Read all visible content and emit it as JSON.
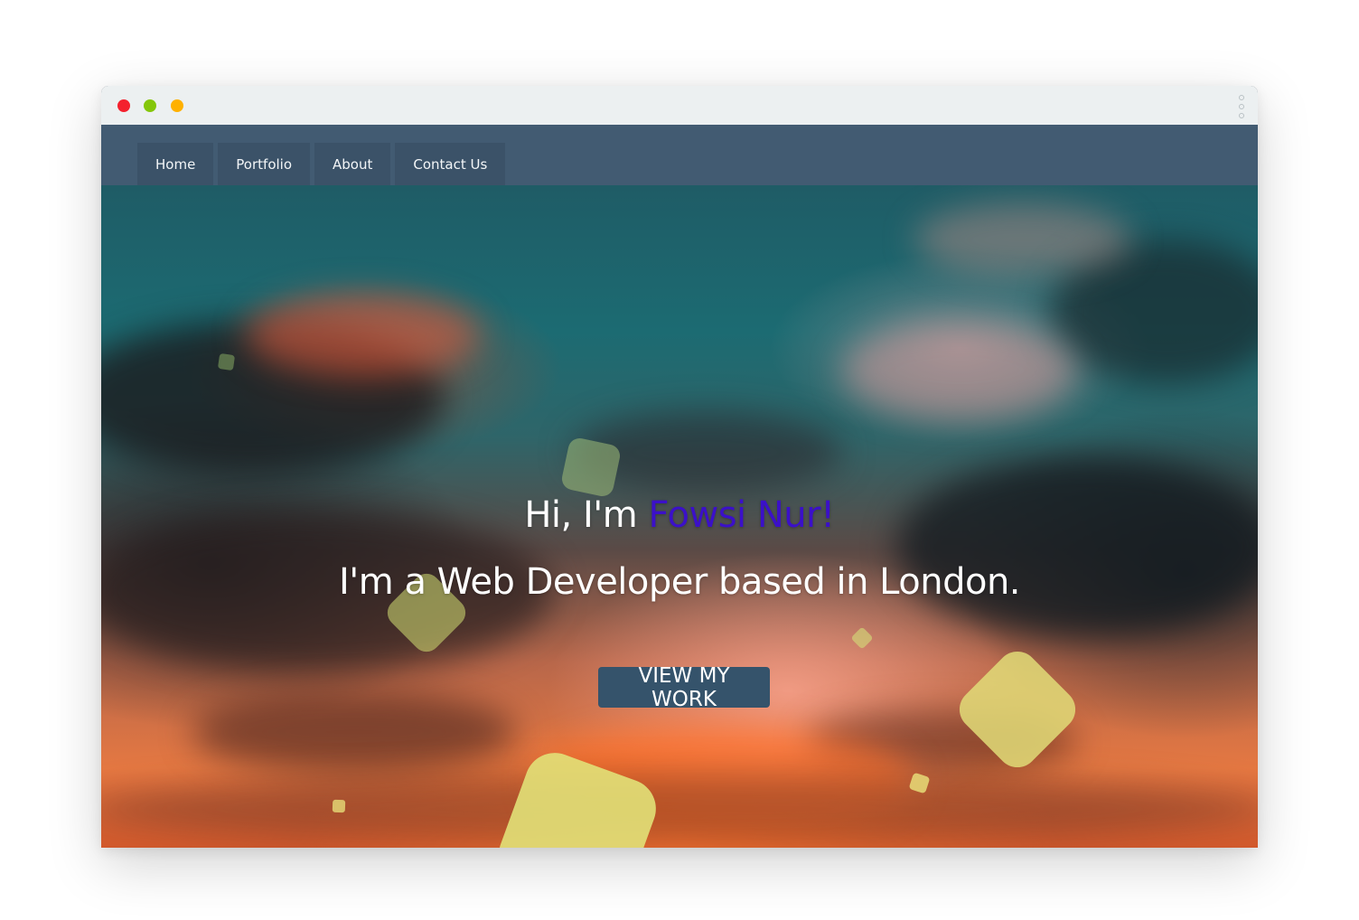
{
  "window": {
    "controls": [
      {
        "name": "close",
        "color": "#f4212e"
      },
      {
        "name": "minimize",
        "color": "#84c60a"
      },
      {
        "name": "maximize",
        "color": "#ffb100"
      }
    ],
    "menu_icon": "vertical-dots-icon"
  },
  "nav": {
    "items": [
      {
        "label": "Home"
      },
      {
        "label": "Portfolio"
      },
      {
        "label": "About"
      },
      {
        "label": "Contact Us"
      }
    ]
  },
  "hero": {
    "greeting_prefix": "Hi, I'm ",
    "name": "Fowsi Nur!",
    "tagline": "I'm a Web Developer based in London.",
    "cta_label": "VIEW MY WORK",
    "colors": {
      "name": "#3b10c9",
      "cta_background": "#35536b",
      "navbar": "#425b72",
      "shapes": "#e6e27a"
    }
  }
}
